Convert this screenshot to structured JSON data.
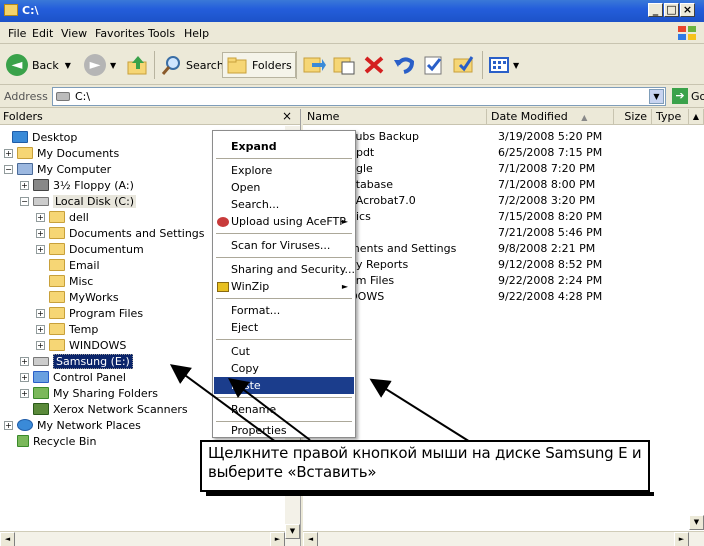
{
  "window": {
    "title": "C:\\"
  },
  "menu": [
    "File",
    "Edit",
    "View",
    "Favorites",
    "Tools",
    "Help"
  ],
  "toolbar": {
    "back": "Back",
    "search": "Search",
    "folders": "Folders"
  },
  "address": {
    "label": "Address",
    "value": "C:\\",
    "go": "Go"
  },
  "folders_pane": {
    "title": "Folders",
    "close": "×",
    "tree": [
      {
        "label": "Desktop"
      },
      {
        "label": "My Documents"
      },
      {
        "label": "My Computer"
      },
      {
        "label": "3½ Floppy (A:)"
      },
      {
        "label": "Local Disk (C:)"
      },
      {
        "label": "dell"
      },
      {
        "label": "Documents and Settings"
      },
      {
        "label": "Documentum"
      },
      {
        "label": "Email"
      },
      {
        "label": "Misc"
      },
      {
        "label": "MyWorks"
      },
      {
        "label": "Program Files"
      },
      {
        "label": "Temp"
      },
      {
        "label": "WINDOWS"
      },
      {
        "label": "Samsung (E:)"
      },
      {
        "label": "Control Panel"
      },
      {
        "label": "My Sharing Folders"
      },
      {
        "label": "Xerox Network Scanners"
      },
      {
        "label": "My Network Places"
      },
      {
        "label": "Recycle Bin"
      }
    ]
  },
  "file_list": {
    "columns": {
      "name": "Name",
      "date": "Date Modified",
      "sort": "▲",
      "size": "Size",
      "type": "Type"
    },
    "rows": [
      {
        "name": "Pubs Backup",
        "date": "3/19/2008 5:20 PM"
      },
      {
        "name": "updt",
        "date": "6/25/2008 7:15 PM"
      },
      {
        "name": "ngle",
        "date": "7/1/2008 7:20 PM"
      },
      {
        "name": "atabase",
        "date": "7/1/2008 8:00 PM"
      },
      {
        "name": "eAcrobat7.0",
        "date": "7/2/2008 3:20 PM"
      },
      {
        "name": "nics",
        "date": "7/15/2008 8:20 PM"
      },
      {
        "name": "",
        "date": "7/21/2008 5:46 PM"
      },
      {
        "name": "ments and Settings",
        "date": "9/8/2008 2:21 PM"
      },
      {
        "name": "dy Reports",
        "date": "9/12/2008 8:52 PM"
      },
      {
        "name": "am Files",
        "date": "9/22/2008 2:24 PM"
      },
      {
        "name": "OOWS",
        "date": "9/22/2008 4:28 PM"
      }
    ]
  },
  "context_menu": {
    "expand": "Expand",
    "explore": "Explore",
    "open": "Open",
    "search": "Search...",
    "upload": "Upload using AceFTP",
    "scan": "Scan for Viruses...",
    "sharing": "Sharing and Security...",
    "winzip": "WinZip",
    "format": "Format...",
    "eject": "Eject",
    "cut": "Cut",
    "copy": "Copy",
    "paste": "Paste",
    "rename": "Rename",
    "properties": "Properties"
  },
  "callout": {
    "text": "Щелкните правой кнопкой мыши на диске Samsung E и выберите «Вставить»"
  },
  "colors": {
    "title_bar": "#245edb",
    "selection": "#0a246a",
    "menu_highlight": "#1b3d8c",
    "go_green": "#3aa24a"
  }
}
